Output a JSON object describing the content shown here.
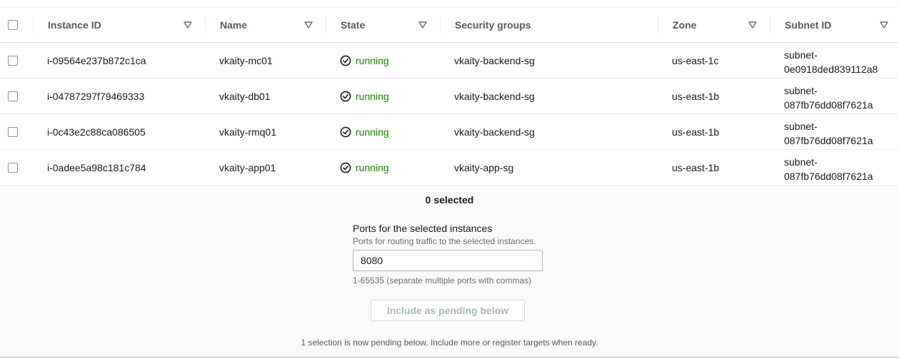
{
  "table": {
    "headers": {
      "instance_id": "Instance ID",
      "name": "Name",
      "state": "State",
      "security_groups": "Security groups",
      "zone": "Zone",
      "subnet_id": "Subnet ID"
    },
    "rows": [
      {
        "instance_id": "i-09564e237b872c1ca",
        "name": "vkaity-mc01",
        "state": "running",
        "security_group": "vkaity-backend-sg",
        "zone": "us-east-1c",
        "subnet_line1": "subnet-",
        "subnet_line2": "0e0918ded839112a8"
      },
      {
        "instance_id": "i-04787297f79469333",
        "name": "vkaity-db01",
        "state": "running",
        "security_group": "vkaity-backend-sg",
        "zone": "us-east-1b",
        "subnet_line1": "subnet-",
        "subnet_line2": "087fb76dd08f7621a"
      },
      {
        "instance_id": "i-0c43e2c88ca086505",
        "name": "vkaity-rmq01",
        "state": "running",
        "security_group": "vkaity-backend-sg",
        "zone": "us-east-1b",
        "subnet_line1": "subnet-",
        "subnet_line2": "087fb76dd08f7621a"
      },
      {
        "instance_id": "i-0adee5a98c181c784",
        "name": "vkaity-app01",
        "state": "running",
        "security_group": "vkaity-app-sg",
        "zone": "us-east-1b",
        "subnet_line1": "subnet-",
        "subnet_line2": "087fb76dd08f7621a"
      }
    ]
  },
  "panel": {
    "selected_count": "0 selected",
    "ports_label": "Ports for the selected instances",
    "ports_description": "Ports for routing traffic to the selected instances.",
    "ports_value": "8080",
    "ports_hint": "1-65535 (separate multiple ports with commas)",
    "pending_button": "Include as pending below",
    "footer_note": "1 selection is now pending below. Include more or register targets when ready."
  },
  "icons": {
    "sort": "sort-caret-down-icon",
    "state": "status-check-circle-icon"
  },
  "colors": {
    "running": "#1d8102",
    "header_text": "#545b64",
    "disabled_button_text": "#aab7b8"
  }
}
